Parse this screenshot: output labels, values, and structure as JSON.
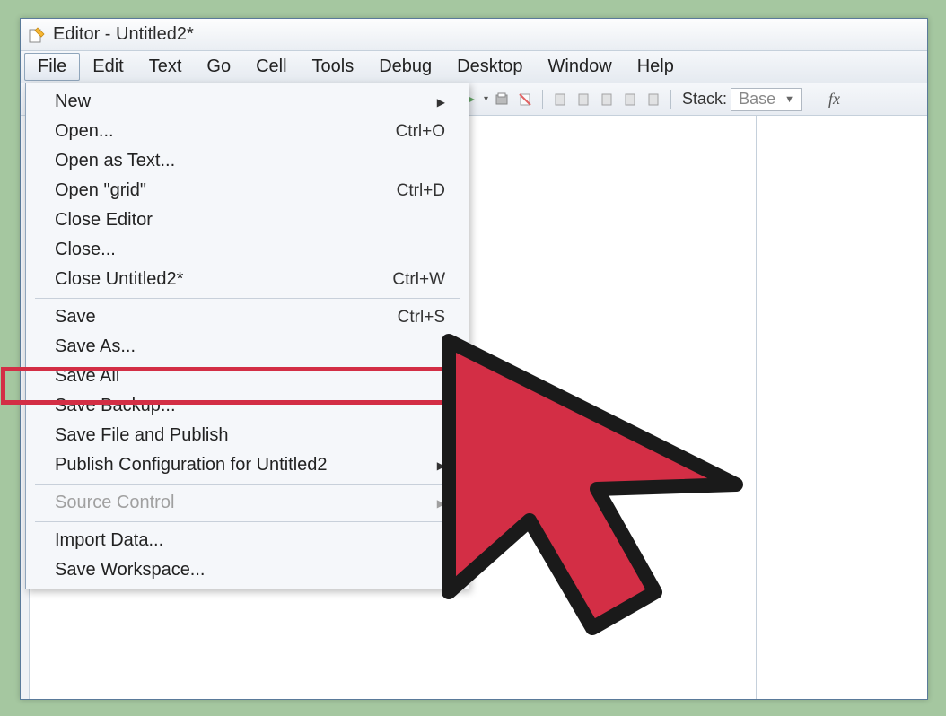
{
  "window": {
    "title": "Editor - Untitled2*"
  },
  "menubar": {
    "items": [
      "File",
      "Edit",
      "Text",
      "Go",
      "Cell",
      "Tools",
      "Debug",
      "Desktop",
      "Window",
      "Help"
    ],
    "active_index": 0
  },
  "toolbar": {
    "stack_label": "Stack:",
    "stack_value": "Base",
    "fx": "fx"
  },
  "file_menu": {
    "items": [
      {
        "label": "New",
        "shortcut": "",
        "has_submenu": true
      },
      {
        "label": "Open...",
        "shortcut": "Ctrl+O"
      },
      {
        "label": "Open as Text...",
        "shortcut": ""
      },
      {
        "label": "Open \"grid\"",
        "shortcut": "Ctrl+D"
      },
      {
        "label": "Close Editor",
        "shortcut": ""
      },
      {
        "label": "Close...",
        "shortcut": ""
      },
      {
        "label": "Close Untitled2*",
        "shortcut": "Ctrl+W"
      },
      {
        "sep": true
      },
      {
        "label": "Save",
        "shortcut": "Ctrl+S"
      },
      {
        "label": "Save As...",
        "shortcut": "",
        "highlighted": true
      },
      {
        "label": "Save All",
        "shortcut": ""
      },
      {
        "label": "Save Backup...",
        "shortcut": ""
      },
      {
        "label": "Save File and Publish",
        "shortcut": ""
      },
      {
        "label": "Publish Configuration for Untitled2",
        "shortcut": "",
        "has_submenu": true
      },
      {
        "sep": true
      },
      {
        "label": "Source Control",
        "shortcut": "",
        "has_submenu": true,
        "disabled": true
      },
      {
        "sep": true
      },
      {
        "label": "Import Data...",
        "shortcut": ""
      },
      {
        "label": "Save Workspace...",
        "shortcut": ""
      }
    ]
  }
}
